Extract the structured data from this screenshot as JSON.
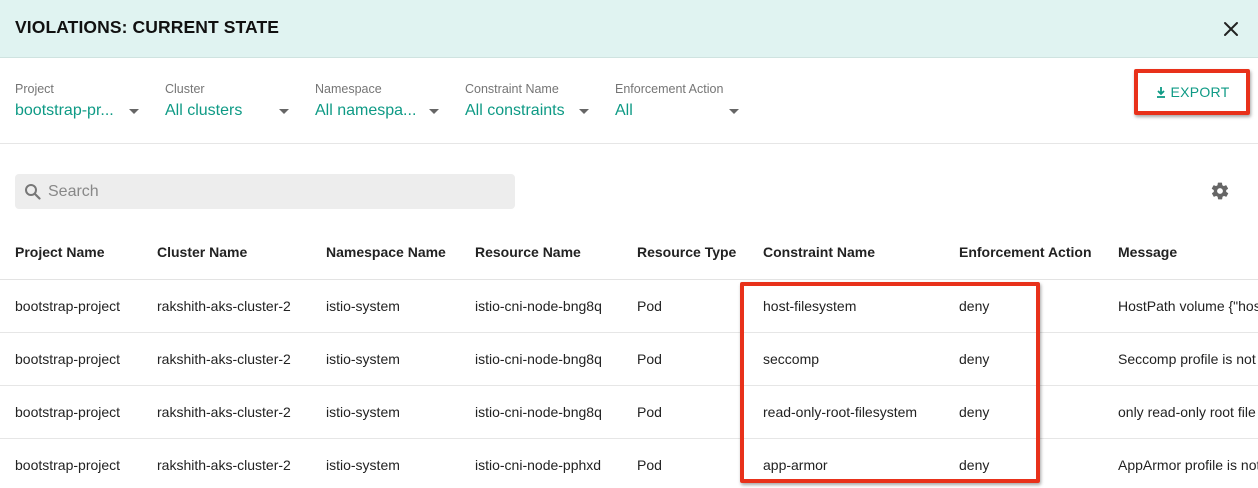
{
  "header": {
    "title": "VIOLATIONS: CURRENT STATE"
  },
  "filters": [
    {
      "label": "Project",
      "value": "bootstrap-pr..."
    },
    {
      "label": "Cluster",
      "value": "All clusters"
    },
    {
      "label": "Namespace",
      "value": "All namespa..."
    },
    {
      "label": "Constraint Name",
      "value": "All constraints"
    },
    {
      "label": "Enforcement Action",
      "value": "All"
    }
  ],
  "export": {
    "label": "EXPORT"
  },
  "search": {
    "placeholder": "Search"
  },
  "table": {
    "columns": [
      "Project Name",
      "Cluster Name",
      "Namespace Name",
      "Resource Name",
      "Resource Type",
      "Constraint Name",
      "Enforcement Action",
      "Message"
    ],
    "rows": [
      [
        "bootstrap-project",
        "rakshith-aks-cluster-2",
        "istio-system",
        "istio-cni-node-bng8q",
        "Pod",
        "host-filesystem",
        "deny",
        "HostPath volume {\"hos"
      ],
      [
        "bootstrap-project",
        "rakshith-aks-cluster-2",
        "istio-system",
        "istio-cni-node-bng8q",
        "Pod",
        "seccomp",
        "deny",
        "Seccomp profile is not"
      ],
      [
        "bootstrap-project",
        "rakshith-aks-cluster-2",
        "istio-system",
        "istio-cni-node-bng8q",
        "Pod",
        "read-only-root-filesystem",
        "deny",
        "only read-only root file"
      ],
      [
        "bootstrap-project",
        "rakshith-aks-cluster-2",
        "istio-system",
        "istio-cni-node-pphxd",
        "Pod",
        "app-armor",
        "deny",
        "AppArmor profile is not"
      ]
    ]
  },
  "colors": {
    "accent": "#0e9a85",
    "header_bg": "#e0f3f1",
    "highlight": "#e8311a"
  },
  "icons": {
    "close": "close-icon",
    "export": "download-icon",
    "search": "search-icon",
    "settings": "gear-icon"
  }
}
